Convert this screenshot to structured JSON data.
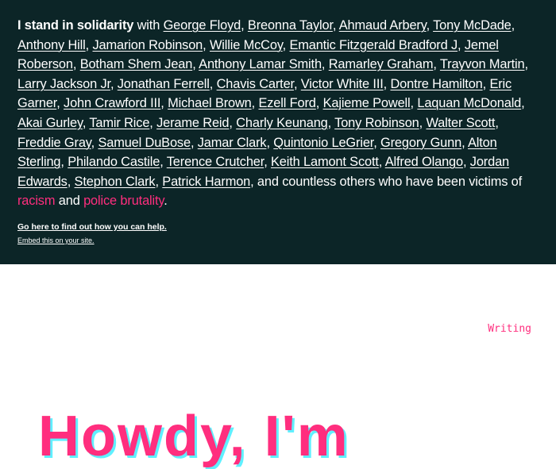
{
  "banner": {
    "intro_bold": "I stand in solidarity",
    "intro_rest": " with ",
    "names": [
      "George Floyd",
      "Breonna Taylor",
      "Ahmaud Arbery",
      "Tony McDade",
      "Anthony Hill",
      "Jamarion Robinson",
      "Willie McCoy",
      "Emantic Fitzgerald Bradford J",
      "Jemel Roberson",
      "Botham Shem Jean",
      "Anthony Lamar Smith",
      "Ramarley Graham",
      "Trayvon Martin",
      "Larry Jackson Jr",
      "Jonathan Ferrell",
      "Chavis Carter",
      "Victor White III",
      "Dontre Hamilton",
      "Eric Garner",
      "John Crawford III",
      "Michael Brown",
      "Ezell Ford",
      "Kajieme Powell",
      "Laquan McDonald",
      "Akai Gurley",
      "Tamir Rice",
      "Jerame Reid",
      "Charly Keunang",
      "Tony Robinson",
      "Walter Scott",
      "Freddie Gray",
      "Samuel DuBose",
      "Jamar Clark",
      "Quintonio LeGrier",
      "Gregory Gunn",
      "Alton Sterling",
      "Philando Castile",
      "Terence Crutcher",
      "Keith Lamont Scott",
      "Alfred Olango",
      "Jordan Edwards",
      "Stephon Clark",
      "Patrick Harmon"
    ],
    "outro": ", and countless others who have been victims of ",
    "racism": "racism",
    "and": " and ",
    "police_brutality": "police brutality",
    "period": ".",
    "help_link": "Go here to find out how you can help.",
    "embed_link": "Embed this on your site."
  },
  "nav": {
    "writing": "Writing"
  },
  "hero": {
    "title": "Howdy, I'm"
  },
  "colors": {
    "banner_bg": "#0c2527",
    "accent_pink": "#ff2e7e",
    "accent_cyan": "#5ff0ff"
  }
}
